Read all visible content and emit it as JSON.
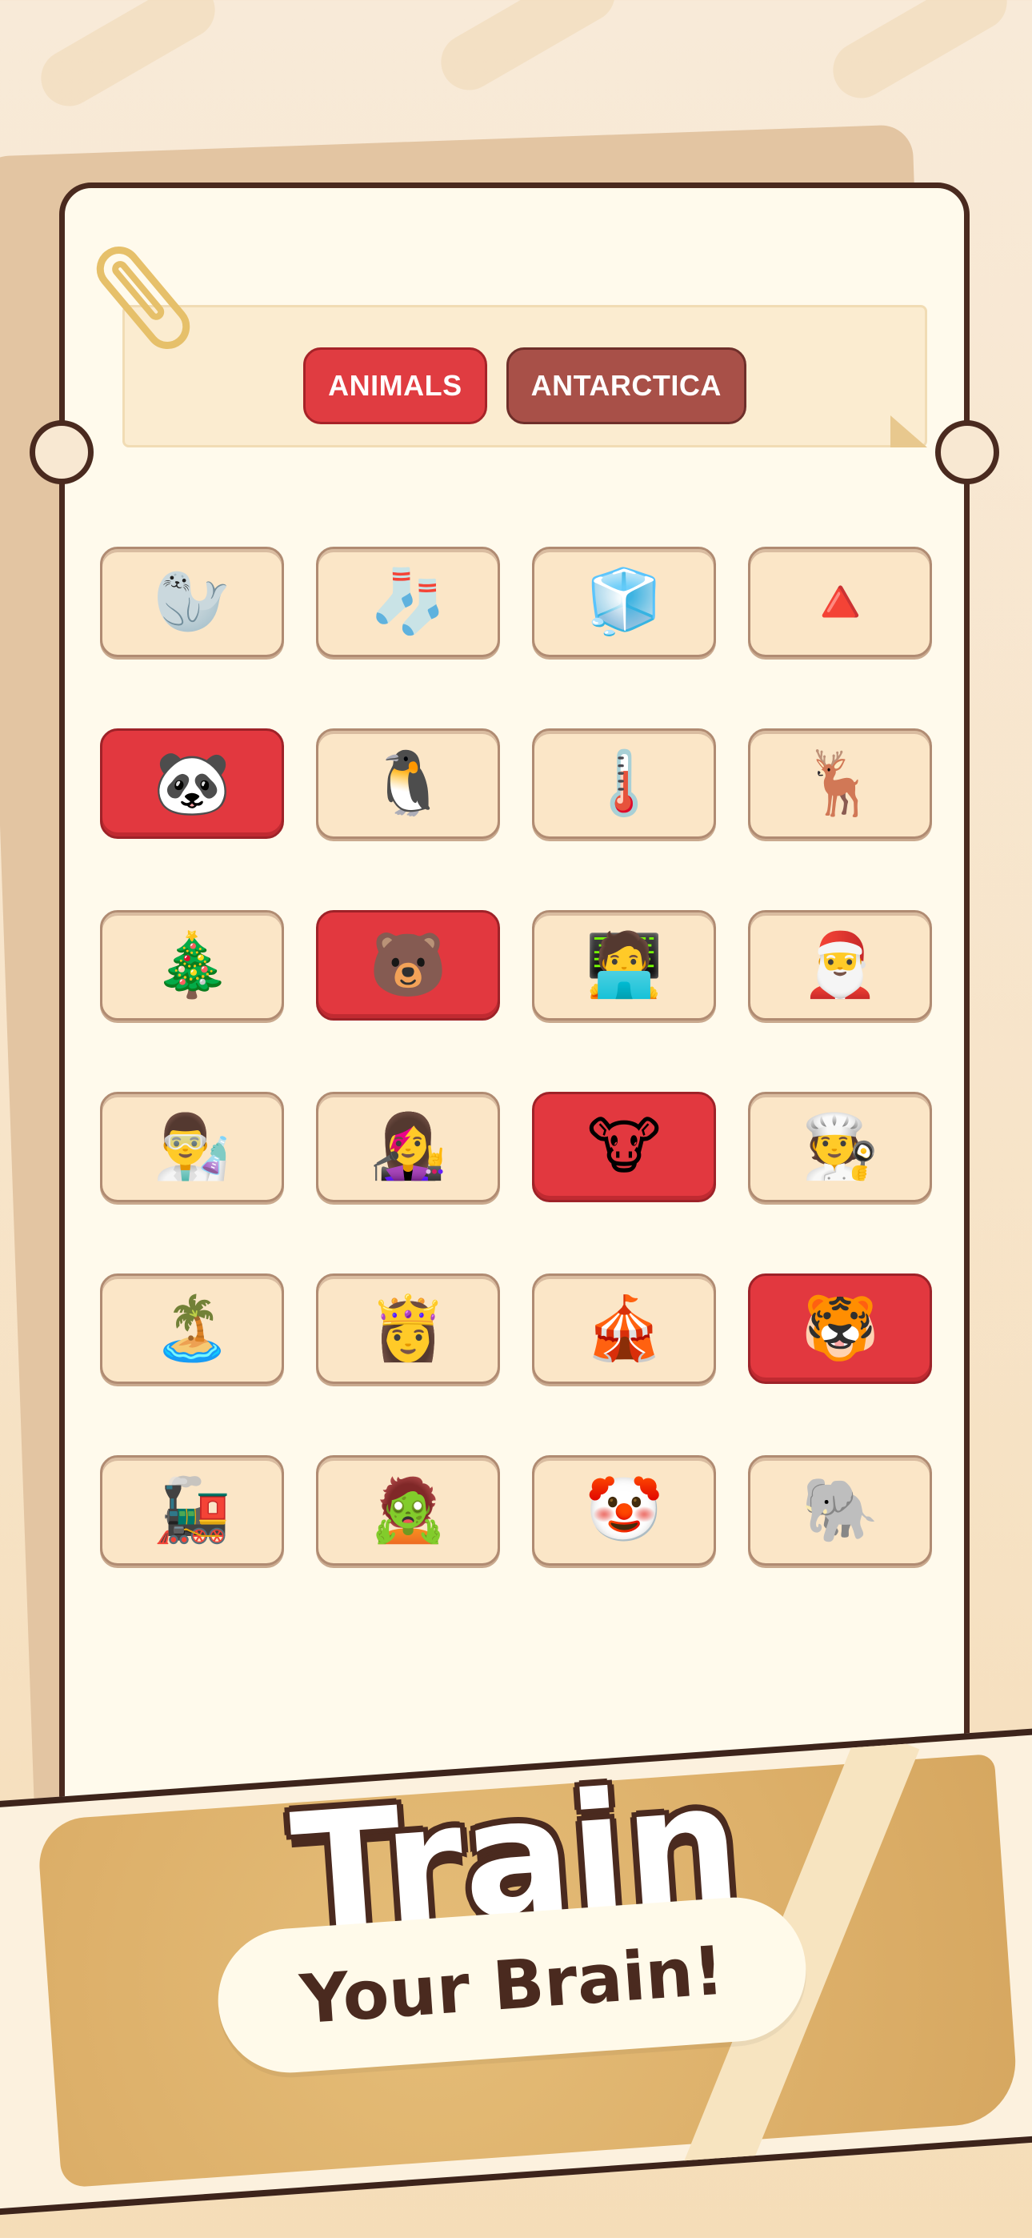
{
  "tags": [
    {
      "label": "ANIMALS",
      "style": "red"
    },
    {
      "label": "ANTARCTICA",
      "style": "brown"
    }
  ],
  "colors": {
    "selected": "#e2383f",
    "tile": "#fbe6c7",
    "outline": "#4a2a1f"
  },
  "tiles": [
    {
      "emoji": "🦭",
      "icon": "seal-icon",
      "selected": false
    },
    {
      "emoji": "🧦",
      "icon": "christmas-stocking-icon",
      "selected": false
    },
    {
      "emoji": "🧊",
      "icon": "iceberg-icon",
      "selected": false
    },
    {
      "emoji": "🔺",
      "icon": "pyramid-icon",
      "selected": false
    },
    {
      "emoji": "🐼",
      "icon": "panda-icon",
      "selected": true
    },
    {
      "emoji": "🐧",
      "icon": "penguin-icon",
      "selected": false
    },
    {
      "emoji": "🌡️",
      "icon": "thermometer-icon",
      "selected": false
    },
    {
      "emoji": "🦌",
      "icon": "deer-icon",
      "selected": false
    },
    {
      "emoji": "🎄",
      "icon": "christmas-trees-icon",
      "selected": false
    },
    {
      "emoji": "🐻",
      "icon": "bear-icon",
      "selected": true
    },
    {
      "emoji": "🧑‍💻",
      "icon": "person-laptop-icon",
      "selected": false
    },
    {
      "emoji": "🎅",
      "icon": "santa-icon",
      "selected": false
    },
    {
      "emoji": "👨‍🔬",
      "icon": "scientist-icon",
      "selected": false
    },
    {
      "emoji": "👩‍🎤",
      "icon": "rockstar-icon",
      "selected": false
    },
    {
      "emoji": "🐮",
      "icon": "cow-icon",
      "selected": true
    },
    {
      "emoji": "🧑‍🍳",
      "icon": "chef-icon",
      "selected": false
    },
    {
      "emoji": "🏝️",
      "icon": "oasis-icon",
      "selected": false
    },
    {
      "emoji": "👸",
      "icon": "pharaoh-icon",
      "selected": false
    },
    {
      "emoji": "🎪",
      "icon": "circus-tent-icon",
      "selected": false
    },
    {
      "emoji": "🐯",
      "icon": "tiger-icon",
      "selected": true
    },
    {
      "emoji": "🚂",
      "icon": "train-icon",
      "selected": false
    },
    {
      "emoji": "🧟",
      "icon": "mummy-icon",
      "selected": false
    },
    {
      "emoji": "🤡",
      "icon": "clown-icon",
      "selected": false
    },
    {
      "emoji": "🐘",
      "icon": "elephant-icon",
      "selected": false
    }
  ],
  "promo": {
    "headline": "Train",
    "subline": "Your Brain!"
  }
}
